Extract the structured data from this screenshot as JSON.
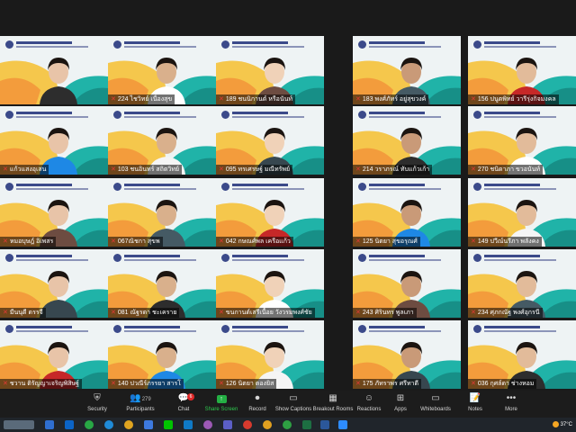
{
  "participants": [
    {
      "name": "",
      "col": 0,
      "row": 0
    },
    {
      "name": "224 ไชวิทย์ เนื่องสุข",
      "col": 1,
      "row": 0
    },
    {
      "name": "189 ชนนิกานต์ หรือนันท์",
      "col": 2,
      "row": 0
    },
    {
      "name": "183 พงศ์ภัทร์ อยู่สุขวงค์",
      "col": 3,
      "row": 0
    },
    {
      "name": "156 ปนูตพิทย์ วารีรุ่งกิจมงคล",
      "col": 4,
      "row": 0
    },
    {
      "name": "แก้วแสงอุเสน",
      "col": 0,
      "row": 1
    },
    {
      "name": "103 ชนอินทร์ สถิตวิทย์",
      "col": 1,
      "row": 1
    },
    {
      "name": "095 ทรเศรษฐ์ มณีทรัพย์",
      "col": 2,
      "row": 1
    },
    {
      "name": "214 วราภรณ์ ทับแก้วเก้า",
      "col": 3,
      "row": 1
    },
    {
      "name": "270 ชนิดาภา ขวอนันท์",
      "col": 4,
      "row": 1
    },
    {
      "name": "หมอบุษฎ์ อิเพสร",
      "col": 0,
      "row": 2
    },
    {
      "name": "067ณิชกา สุขพ",
      "col": 1,
      "row": 2
    },
    {
      "name": "042 กษณศ์พล เครือแก้ว",
      "col": 2,
      "row": 2
    },
    {
      "name": "125 นิตยา สุขอรุณศ์",
      "col": 3,
      "row": 2
    },
    {
      "name": "149 ปวีณ์นรีภา พลังคง",
      "col": 4,
      "row": 2
    },
    {
      "name": "มีนนุดี ดรรจี",
      "col": 0,
      "row": 3
    },
    {
      "name": "081 ณัฐรดา ชะเคราย",
      "col": 1,
      "row": 3
    },
    {
      "name": "ขนกานต์เสรีเนื้อย วังวรมพงศ์ชัย",
      "col": 2,
      "row": 3
    },
    {
      "name": "243 ศิรินทร พูลเภา",
      "col": 3,
      "row": 3
    },
    {
      "name": "234 ศุภกณัฐ พงศ์อุกรนี",
      "col": 4,
      "row": 3
    },
    {
      "name": "ชวาน ติรัญญาเจริญพิสิษฐ์",
      "col": 0,
      "row": 4
    },
    {
      "name": "140 ปวณีร์ภรรยา สารโ",
      "col": 1,
      "row": 4
    },
    {
      "name": "126 นิตยา ตองยิส",
      "col": 2,
      "row": 4
    },
    {
      "name": "175 ภัทราพร ศรีทาดี",
      "col": 3,
      "row": 4
    },
    {
      "name": "036 กุศล์ดา ช่างหอม",
      "col": 4,
      "row": 4
    }
  ],
  "toolbar": {
    "security": "Security",
    "participants": "Participants",
    "participants_count": "279",
    "chat": "Chat",
    "chat_badge": "6",
    "share_screen": "Share Screen",
    "record": "Record",
    "show_captions": "Show Captions",
    "breakout_rooms": "Breakout Rooms",
    "reactions": "Reactions",
    "apps": "Apps",
    "whiteboards": "Whiteboards",
    "notes": "Notes",
    "more": "More"
  },
  "taskbar": {
    "temperature": "37°C",
    "weather_icon": "sun-icon"
  },
  "colors": {
    "share_green": "#24b044",
    "toolbar_bg": "#1c1c1c",
    "taskbar_bg": "#20252b"
  }
}
